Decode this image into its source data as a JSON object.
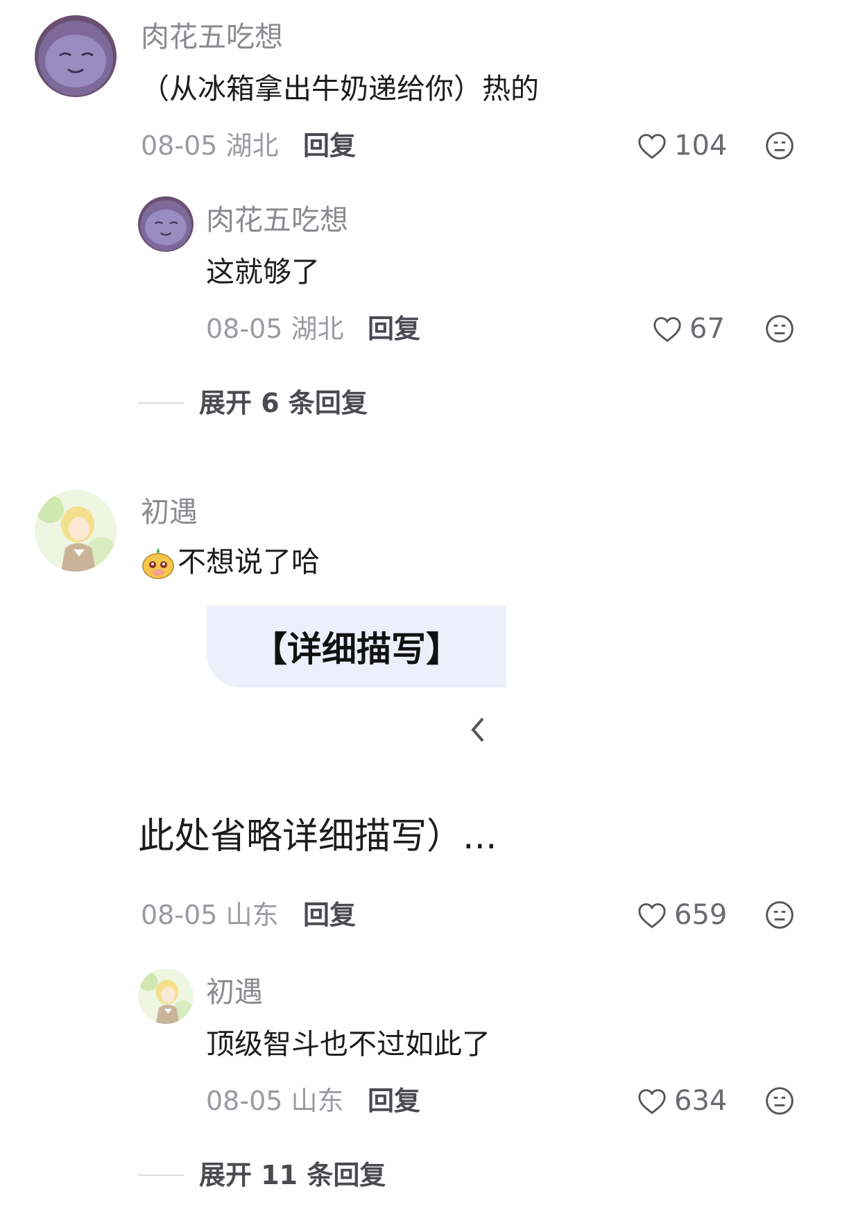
{
  "comments": [
    {
      "user": "肉花五吃想",
      "text": "（从冰箱拿出牛奶递给你）热的",
      "meta": "08-05 湖北",
      "reply": "回复",
      "likes": "104",
      "sub": {
        "user": "肉花五吃想",
        "text": "这就够了",
        "meta": "08-05 湖北",
        "reply": "回复",
        "likes": "67"
      },
      "expand": "展开 6 条回复"
    },
    {
      "user": "初遇",
      "text": "不想说了哈",
      "image_bubble": "【详细描写】",
      "continuation": "此处省略详细描写）...",
      "meta": "08-05 山东",
      "reply": "回复",
      "likes": "659",
      "sub": {
        "user": "初遇",
        "text": "顶级智斗也不过如此了",
        "meta": "08-05 山东",
        "reply": "回复",
        "likes": "634"
      },
      "expand": "展开 11 条回复"
    }
  ],
  "icons": {
    "like": "heart-outline-icon",
    "dislike": "meh-face-icon",
    "emoji": "cute-emoji-icon",
    "back": "chevron-left-icon"
  }
}
